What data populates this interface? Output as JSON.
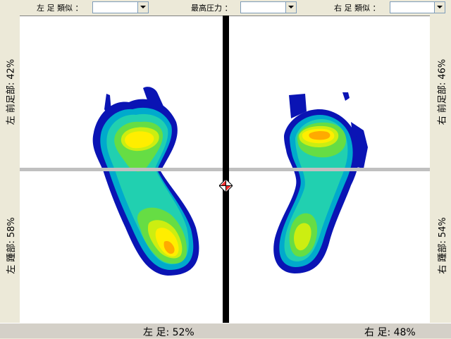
{
  "toolbar": {
    "left_foot_type_label": "左 足 類似 ：",
    "left_foot_type_value": "",
    "max_pressure_label": "最高圧力 ：",
    "max_pressure_value": "",
    "right_foot_type_label": "右 足 類似 ：",
    "right_foot_type_value": ""
  },
  "side": {
    "left_forefoot": "左 前足部: 42%",
    "left_heel": "左 踵部: 58%",
    "right_forefoot": "右 前足部: 46%",
    "right_heel": "右 踵部: 54%"
  },
  "bottom": {
    "left_foot": "左 足: 52%",
    "right_foot": "右 足: 48%"
  },
  "colors": {
    "heat_blue": "#0a14b4",
    "heat_cyan": "#00aacc",
    "heat_aqua": "#21d0b0",
    "heat_green": "#66dd44",
    "heat_lime": "#ccee11",
    "heat_yellow": "#ffee00",
    "heat_orange": "#ffaa00"
  }
}
